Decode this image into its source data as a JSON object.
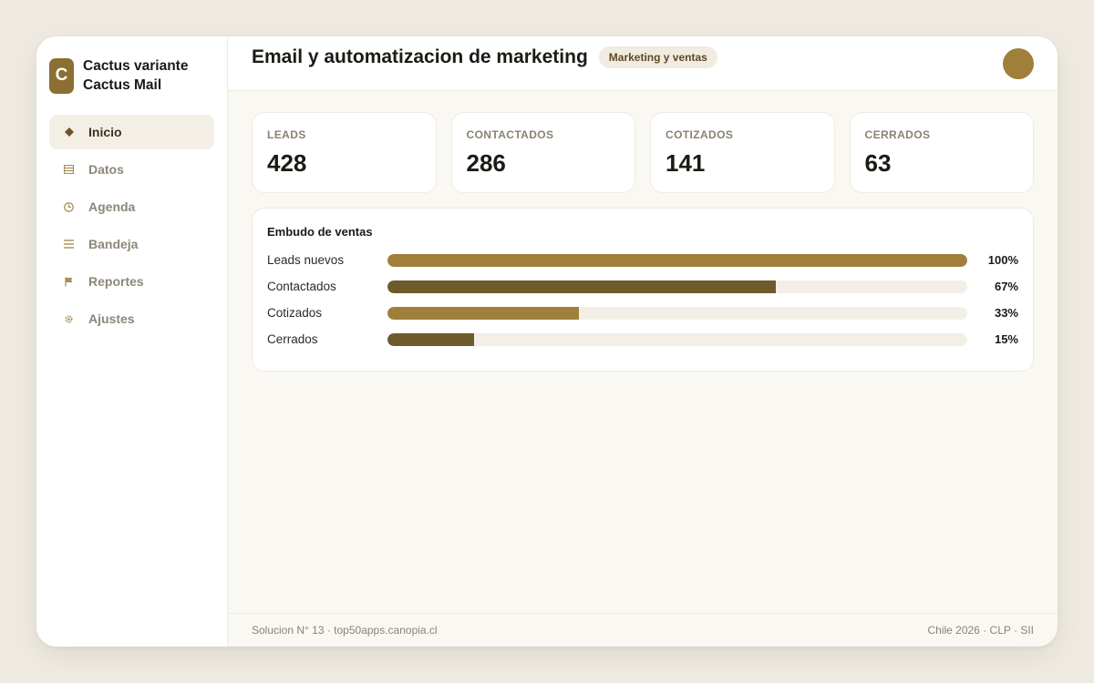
{
  "brand": {
    "logo_letter": "C",
    "name_line1": "Cactus variante",
    "name_line2": "Cactus Mail"
  },
  "sidebar": {
    "items": [
      {
        "label": "Inicio",
        "icon": "diamond-icon",
        "active": true
      },
      {
        "label": "Datos",
        "icon": "table-icon",
        "active": false
      },
      {
        "label": "Agenda",
        "icon": "clock-icon",
        "active": false
      },
      {
        "label": "Bandeja",
        "icon": "list-icon",
        "active": false
      },
      {
        "label": "Reportes",
        "icon": "flag-icon",
        "active": false
      },
      {
        "label": "Ajustes",
        "icon": "gear-icon",
        "active": false
      }
    ]
  },
  "header": {
    "title": "Email y automatizacion de marketing",
    "badge": "Marketing y ventas"
  },
  "stats": [
    {
      "label": "LEADS",
      "value": "428"
    },
    {
      "label": "CONTACTADOS",
      "value": "286"
    },
    {
      "label": "COTIZADOS",
      "value": "141"
    },
    {
      "label": "CERRADOS",
      "value": "63"
    }
  ],
  "funnel": {
    "title": "Embudo de ventas",
    "rows": [
      {
        "label": "Leads nuevos",
        "pct_text": "100%",
        "fraction": 1.0,
        "color": "#a07f3a"
      },
      {
        "label": "Contactados",
        "pct_text": "67%",
        "fraction": 0.67,
        "color": "#6e5a2b"
      },
      {
        "label": "Cotizados",
        "pct_text": "33%",
        "fraction": 0.33,
        "color": "#a07f3a"
      },
      {
        "label": "Cerrados",
        "pct_text": "15%",
        "fraction": 0.15,
        "color": "#6e5a2b"
      }
    ]
  },
  "footer": {
    "left": "Solucion N° 13 · top50apps.canopia.cl",
    "right": "Chile 2026 · CLP · SII"
  },
  "colors": {
    "accent": "#a07f3a",
    "accent_dark": "#6e5a2b",
    "active_bg": "#f3efe5"
  }
}
